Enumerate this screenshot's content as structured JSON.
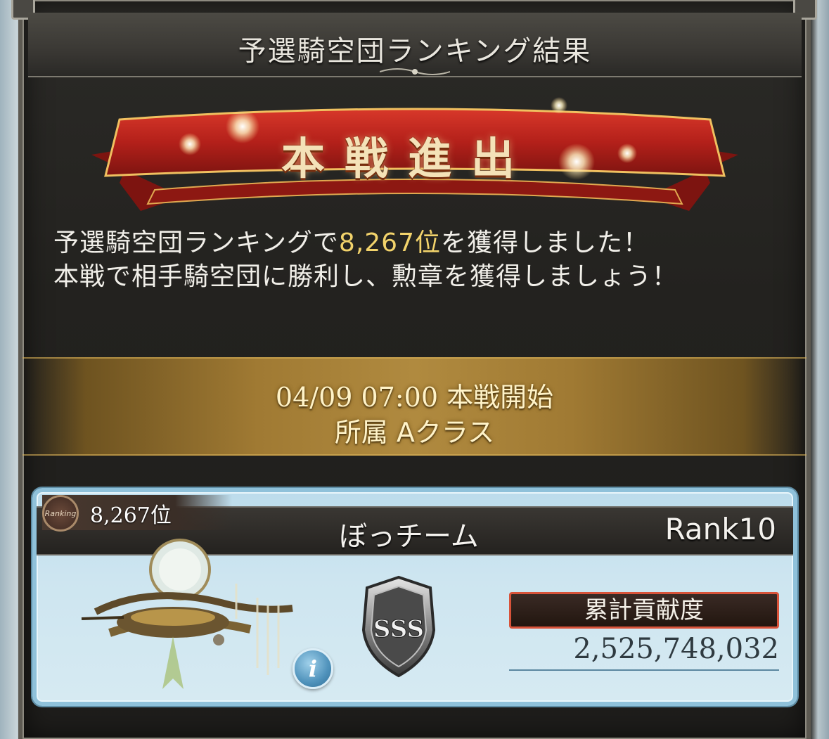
{
  "window": {
    "title": "予選騎空団ランキング結果"
  },
  "banner": {
    "text": "本戦進出"
  },
  "message": {
    "line1_pre": "予選騎空団ランキングで",
    "line1_rank": "8,267位",
    "line1_post": "を獲得しました！",
    "line2": "本戦で相手騎空団に勝利し、勲章を獲得しましょう！"
  },
  "schedule": {
    "start": "04/09 07:00 本戦開始",
    "class": "所属 Aクラス"
  },
  "guild": {
    "rank_badge": "Ranking",
    "rank_position": "8,267位",
    "name": "ぼっチーム",
    "rank_level": "Rank10",
    "grade": "SSS",
    "contribution_label": "累計貢献度",
    "contribution_value": "2,525,748,032",
    "info_icon_label": "i"
  },
  "colors": {
    "highlight": "#f2d36b",
    "ribbon_red": "#b3201a",
    "card_border": "#8fc1da",
    "contrib_border": "#d8533a"
  }
}
